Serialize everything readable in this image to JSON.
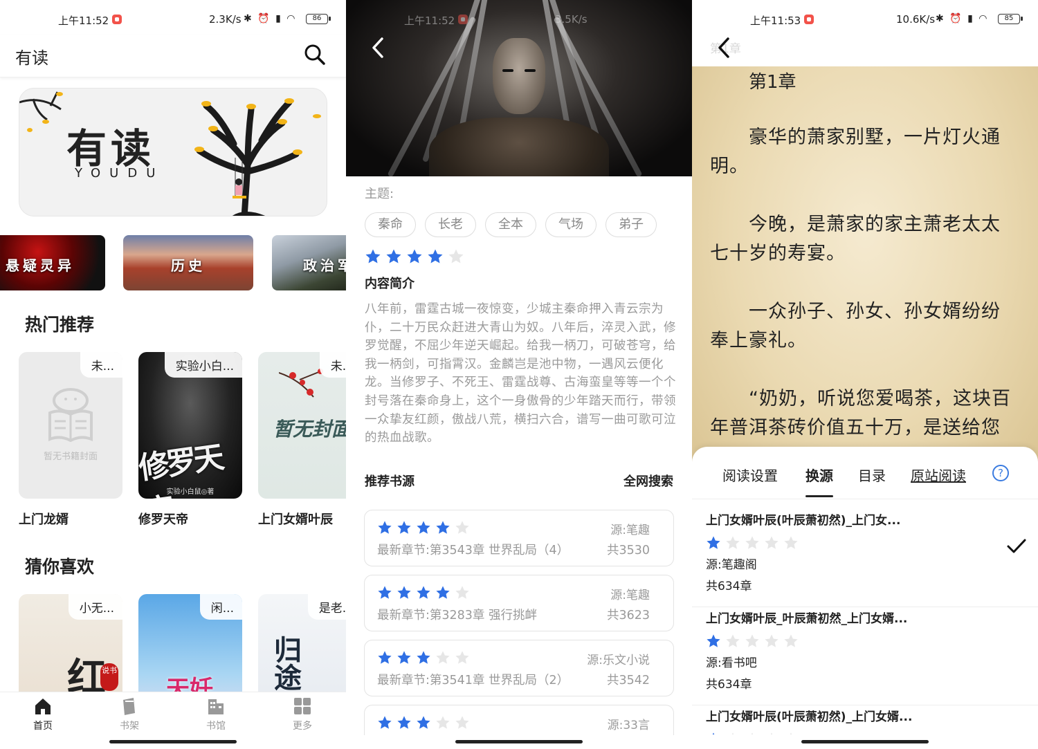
{
  "colors": {
    "star_active": "#2f6fe4",
    "star_inactive": "#e6e6e6",
    "accent": "#3a7be0"
  },
  "screen1": {
    "status": {
      "time": "上午11:52",
      "speed": "2.3K/s",
      "battery": "86"
    },
    "app_title": "有读",
    "banner": {
      "title": "有读",
      "subtitle": "YOUDU"
    },
    "categories": [
      "悬疑灵异",
      "历史",
      "政治军"
    ],
    "hot_title": "热门推荐",
    "hot_books": [
      {
        "tag": "未...",
        "name": "上门龙婿",
        "placeholder": "暂无书籍封面"
      },
      {
        "tag": "实验小白...",
        "name": "修罗天帝",
        "cover_title": "修罗天帝",
        "cover_author": "实验小白鼠◎著"
      },
      {
        "tag": "未...",
        "name": "上门女婿叶辰",
        "cover_title": "暂无封面"
      }
    ],
    "guess_title": "猜你喜欢",
    "guess_books": [
      {
        "tag": "小无...",
        "cover_title": "红",
        "cover_badge": "说书"
      },
      {
        "tag": "闲...",
        "cover_title": "天妊"
      },
      {
        "tag": "是老...",
        "cover_title": "归途曲"
      }
    ],
    "tabs": [
      "首页",
      "书架",
      "书馆",
      "更多"
    ]
  },
  "screen2": {
    "status": {
      "time": "上午11:52",
      "speed": "3.5K/s"
    },
    "theme_label": "主题:",
    "chips": [
      "秦命",
      "长老",
      "全本",
      "气场",
      "弟子"
    ],
    "rating": 4,
    "intro_title": "内容简介",
    "synopsis": "八年前，雷霆古城一夜惊变，少城主秦命押入青云宗为仆，二十万民众赶进大青山为奴。八年后，淬灵入武，修罗觉醒，不屈少年逆天崛起。给我一柄刀，可破苍穹，给我一柄剑，可指霄汉。金麟岂是池中物，一遇风云便化龙。当修罗子、不死王、雷霆战尊、古海蛮皇等等一个个封号落在秦命身上，这个一身傲骨的少年踏天而行，带领一众挚友红颜，傲战八荒，横扫六合，谱写一曲可歌可泣的热血战歌。",
    "rec_title": "推荐书源",
    "search_all": "全网搜索",
    "sources": [
      {
        "rating": 4,
        "name": "源:笔趣",
        "latest": "最新章节:第3543章 世界乱局（4）",
        "total": "共3530"
      },
      {
        "rating": 4,
        "name": "源:笔趣",
        "latest": "最新章节:第3283章 强行挑衅",
        "total": "共3623"
      },
      {
        "rating": 3,
        "name": "源:乐文小说",
        "latest": "最新章节:第3541章 世界乱局（2）",
        "total": "共3542"
      },
      {
        "rating": 3,
        "name": "源:33言",
        "latest": "",
        "total": ""
      }
    ]
  },
  "screen3": {
    "status": {
      "time": "上午11:53",
      "speed": "10.6K/s",
      "battery": "85"
    },
    "ghost_title": "第1章",
    "chapter_title": "第1章",
    "paragraphs": [
      "豪华的萧家别墅，一片灯火通明。",
      "今晚，是萧家的家主萧老太太七十岁的寿宴。",
      "一众孙子、孙女、孙女婿纷纷奉上豪礼。",
      "“奶奶，听说您爱喝茶，这块百年普洱茶砖价值五十万，是送给您"
    ],
    "tabs": [
      "阅读设置",
      "换源",
      "目录",
      "原站阅读"
    ],
    "help": "?",
    "sources": [
      {
        "title": "上门女婿叶辰(叶辰萧初然)_上门女...",
        "rating": 1,
        "source": "源:笔趣阁",
        "count": "共634章",
        "selected": true
      },
      {
        "title": "上门女婿叶辰_叶辰萧初然_上门女婿...",
        "rating": 1,
        "source": "源:看书吧",
        "count": "共634章",
        "selected": false
      },
      {
        "title": "上门女婿叶辰(叶辰萧初然)_上门女婿...",
        "rating": 1,
        "source": "",
        "count": "",
        "selected": false
      }
    ]
  }
}
